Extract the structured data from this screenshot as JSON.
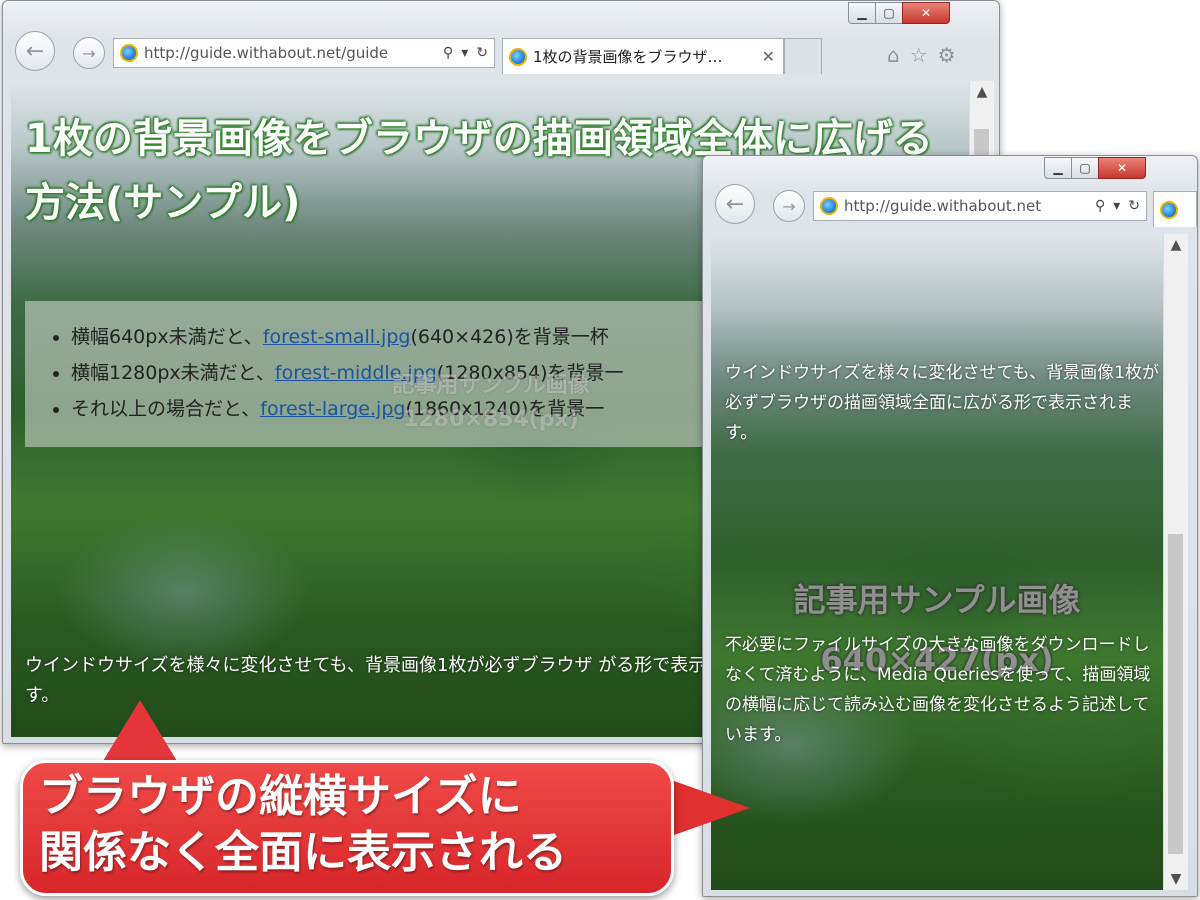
{
  "big_window": {
    "url": "http://guide.withabout.net/guide",
    "tab_title": "1枚の背景画像をブラウザ…",
    "page": {
      "title": "1枚の背景画像をブラウザの描画領域全体に広げる方法(サンプル)",
      "list": [
        {
          "pre": "横幅640px未満だと、",
          "link": "forest-small.jpg",
          "post": "(640×426)を背景一杯"
        },
        {
          "pre": "横幅1280px未満だと、",
          "link": "forest-middle.jpg",
          "post": "(1280x854)を背景一"
        },
        {
          "pre": "それ以上の場合だと、",
          "link": "forest-large.jpg",
          "post": "(1860x1240)を背景一"
        }
      ],
      "watermark_line1": "記事用サンプル画像",
      "watermark_line2": "1280×854(px)",
      "body_text": "ウインドウサイズを様々に変化させても、背景画像1枚が必ずブラウザ がる形で表示されます。"
    }
  },
  "small_window": {
    "url": "http://guide.withabout.net",
    "page": {
      "text1": "ウインドウサイズを様々に変化させても、背景画像1枚が必ずブラウザの描画領域全面に広がる形で表示されます。",
      "watermark_line1": "記事用サンプル画像",
      "watermark_line2": "640×427(px)",
      "text2": "不必要にファイルサイズの大きな画像をダウンロードしなくて済むように、Media Queriesを使って、描画領域の横幅に応じて読み込む画像を変化させるよう記述しています。"
    }
  },
  "callout": {
    "line1": "ブラウザの縦横サイズに",
    "line2": "関係なく全面に表示される"
  },
  "icons": {
    "back": "back-arrow-icon",
    "forward": "forward-arrow-icon",
    "search": "search-icon",
    "refresh": "refresh-icon",
    "home": "home-icon",
    "favorites": "star-icon",
    "settings": "gear-icon"
  },
  "colors": {
    "callout_red": "#e0302f",
    "title_glow": "#2f8a2a",
    "link": "#1a55a0",
    "close_button": "#c9372c"
  }
}
